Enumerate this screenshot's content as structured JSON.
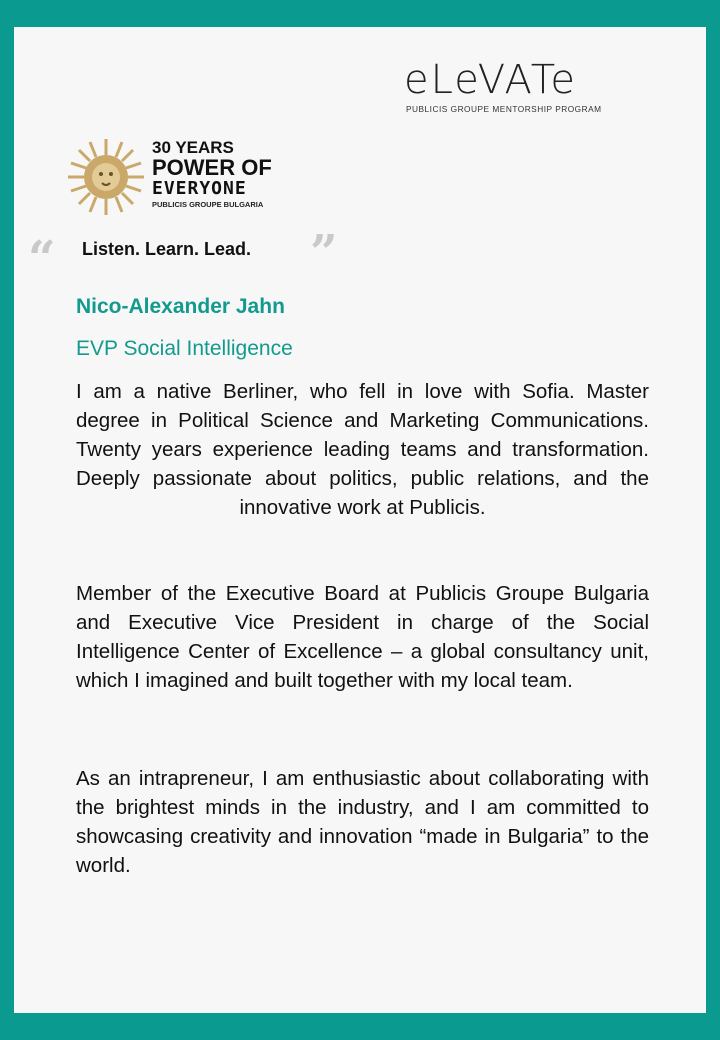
{
  "logo": {
    "elevate_word": "eLeVATe",
    "elevate_subtitle": "PUBLICIS GROUPE MENTORSHIP PROGRAM",
    "anniversary_line1": "30 YEARS",
    "anniversary_line2": "POWER OF",
    "anniversary_line3": "EVERYONE",
    "anniversary_line4": "PUBLICIS GROUPE BULGARIA"
  },
  "tagline": "Listen. Learn. Lead.",
  "quote_open": "“",
  "quote_close": "”",
  "profile": {
    "name": "Nico-Alexander Jahn",
    "role": "EVP Social Intelligence"
  },
  "bio": {
    "p1": "I am a native Berliner, who fell in love with Sofia. Master degree in Political Science and Marketing Communications. Twenty years experience leading teams and transformation. Deeply passionate about politics, public relations, and the innovative work at Publicis.",
    "p2": "Member of the Executive Board at Publicis Groupe Bulgaria and Executive Vice President in charge of the Social Intelligence Center of Excellence – a global consultancy unit, which I imagined and built together with my local team.",
    "p3": "As an intrapreneur, I am enthusiastic about collaborating with the brightest minds in the industry, and I am committed to showcasing creativity and innovation “made in Bulgaria” to the world."
  },
  "colors": {
    "border": "#0a9a8f",
    "accent": "#139a8e",
    "background": "#f7f7f7"
  }
}
